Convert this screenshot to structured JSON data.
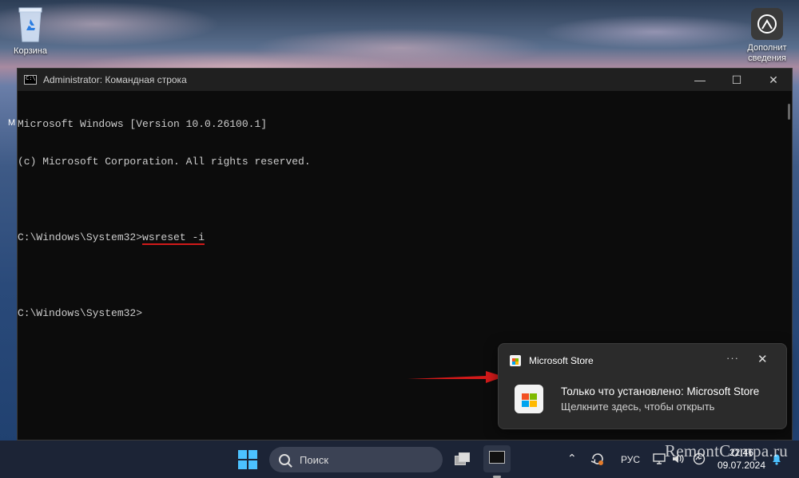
{
  "desktop": {
    "recycle_bin_label": "Корзина",
    "info_label_1": "Дополнит",
    "info_label_2": "сведения",
    "left_sliver_text": "M"
  },
  "window": {
    "title": "Administrator: Командная строка",
    "minimize_glyph": "—",
    "maximize_glyph": "☐",
    "close_glyph": "✕"
  },
  "console": {
    "line1": "Microsoft Windows [Version 10.0.26100.1]",
    "line2": "(c) Microsoft Corporation. All rights reserved.",
    "prompt1": "C:\\Windows\\System32>",
    "command1": "wsreset -i",
    "prompt2": "C:\\Windows\\System32>"
  },
  "toast": {
    "app_name": "Microsoft Store",
    "more_glyph": "···",
    "close_glyph": "✕",
    "title": "Только что установлено: Microsoft Store",
    "subtitle": "Щелкните здесь, чтобы открыть"
  },
  "taskbar": {
    "search_placeholder": "Поиск",
    "lang": "РУС",
    "chevron": "⌃",
    "time": "22:46",
    "date": "09.07.2024"
  },
  "watermark": "RemontCompa.ru",
  "colors": {
    "annotation_red": "#d21a1a",
    "accent_blue": "#4cc2ff"
  }
}
